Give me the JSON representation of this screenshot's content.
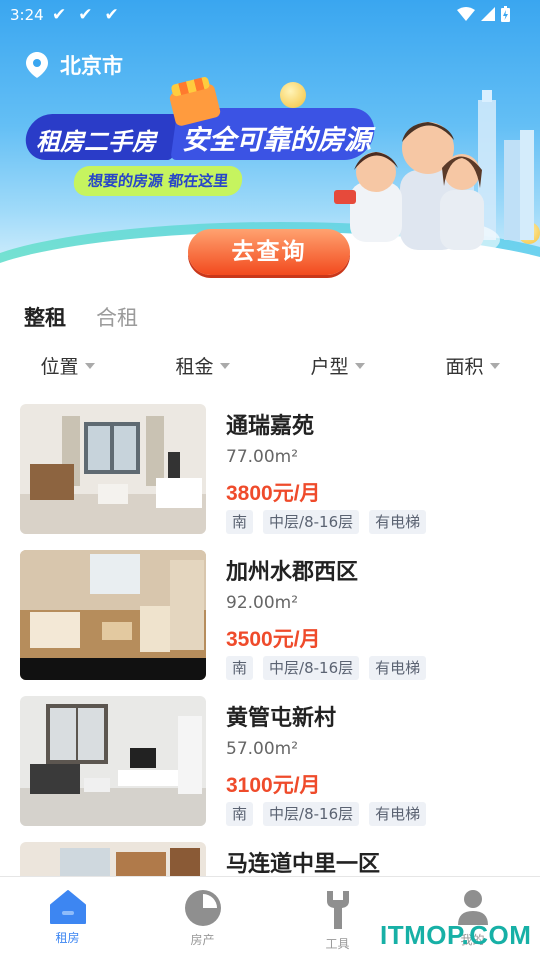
{
  "status_bar": {
    "time": "3:24",
    "watermark": "ITMOP.COM"
  },
  "header": {
    "city": "北京市"
  },
  "banner": {
    "slogan_left": "租房二手房",
    "slogan_right": "安全可靠的房源",
    "sub_slogan": "想要的房源 都在这里",
    "cta_label": "去查询"
  },
  "tabs": [
    {
      "label": "整租",
      "active": true
    },
    {
      "label": "合租",
      "active": false
    }
  ],
  "filters": [
    {
      "label": "位置"
    },
    {
      "label": "租金"
    },
    {
      "label": "户型"
    },
    {
      "label": "面积"
    }
  ],
  "listings": [
    {
      "name": "通瑞嘉苑",
      "area": "77.00m²",
      "price": "3800元/月",
      "tags": [
        "南",
        "中层/8-16层",
        "有电梯"
      ]
    },
    {
      "name": "加州水郡西区",
      "area": "92.00m²",
      "price": "3500元/月",
      "tags": [
        "南",
        "中层/8-16层",
        "有电梯"
      ]
    },
    {
      "name": "黄管屯新村",
      "area": "57.00m²",
      "price": "3100元/月",
      "tags": [
        "南",
        "中层/8-16层",
        "有电梯"
      ]
    },
    {
      "name": "马连道中里一区",
      "area": "",
      "price": "",
      "tags": []
    }
  ],
  "bottom_nav": [
    {
      "label": "租房",
      "icon": "house-icon",
      "active": true
    },
    {
      "label": "房产",
      "icon": "pie-chart-icon",
      "active": false
    },
    {
      "label": "工具",
      "icon": "wrench-icon",
      "active": false
    },
    {
      "label": "我的",
      "icon": "user-icon",
      "active": false
    }
  ],
  "watermark": "ITMOP.COM",
  "colors": {
    "accent": "#3d86f2",
    "price": "#ef4b2b",
    "tab_underline": "#8ee8b6",
    "cta": "#f24a1e"
  }
}
